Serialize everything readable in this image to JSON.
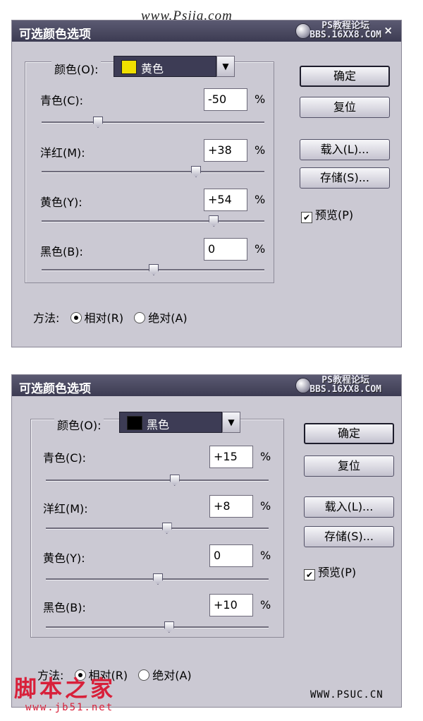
{
  "watermark_top": "www.Psjia.com",
  "dialogs": [
    {
      "title": "可选颜色选项",
      "forum_line1": "PS教程论坛",
      "forum_line2": "BBS.16XX8.COM",
      "close": "×",
      "color_label": "颜色(O):",
      "color_value": "黄色",
      "swatch_color": "#f0e000",
      "rows": [
        {
          "label": "青色(C):",
          "value": "-50",
          "unit": "%",
          "slider": -50
        },
        {
          "label": "洋红(M):",
          "value": "+38",
          "unit": "%",
          "slider": 38
        },
        {
          "label": "黄色(Y):",
          "value": "+54",
          "unit": "%",
          "slider": 54
        },
        {
          "label": "黑色(B):",
          "value": "0",
          "unit": "%",
          "slider": 0
        }
      ],
      "buttons": {
        "ok": "确定",
        "reset": "复位",
        "load": "载入(L)...",
        "save": "存储(S)..."
      },
      "preview_label": "预览(P)",
      "preview_checked": true,
      "method_label": "方法:",
      "method_relative": "相对(R)",
      "method_absolute": "绝对(A)",
      "method_selected": "relative"
    },
    {
      "title": "可选颜色选项",
      "forum_line1": "PS教程论坛",
      "forum_line2": "BBS.16XX8.COM",
      "close": "",
      "color_label": "颜色(O):",
      "color_value": "黑色",
      "swatch_color": "#000000",
      "rows": [
        {
          "label": "青色(C):",
          "value": "+15",
          "unit": "%",
          "slider": 15
        },
        {
          "label": "洋红(M):",
          "value": "+8",
          "unit": "%",
          "slider": 8
        },
        {
          "label": "黄色(Y):",
          "value": "0",
          "unit": "%",
          "slider": 0
        },
        {
          "label": "黑色(B):",
          "value": "+10",
          "unit": "%",
          "slider": 10
        }
      ],
      "buttons": {
        "ok": "确定",
        "reset": "复位",
        "load": "载入(L)...",
        "save": "存储(S)..."
      },
      "preview_label": "预览(P)",
      "preview_checked": true,
      "method_label": "方法:",
      "method_relative": "相对(R)",
      "method_absolute": "绝对(A)",
      "method_selected": "relative"
    }
  ],
  "watermark_cn": "脚本之家",
  "watermark_url": "www.jb51.net",
  "watermark_psuc": "WWW.PSUC.CN"
}
